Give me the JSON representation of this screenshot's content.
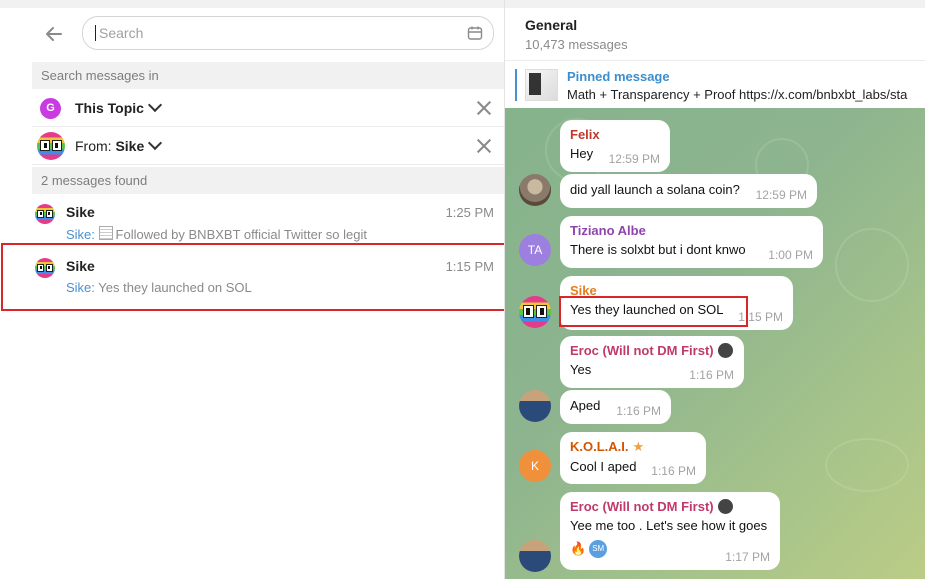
{
  "search": {
    "placeholder": "Search",
    "search_in_label": "Search messages in",
    "topic_filter": {
      "avatar_letter": "G",
      "label": "This Topic"
    },
    "from_filter": {
      "prefix": "From:",
      "name": "Sike"
    },
    "found_label": "2 messages found",
    "results": [
      {
        "name": "Sike",
        "time": "1:25 PM",
        "who": "Sike:",
        "snippet": "Followed by BNBXBT official Twitter so legit"
      },
      {
        "name": "Sike",
        "time": "1:15 PM",
        "who": "Sike:",
        "snippet": "Yes they launched on SOL"
      }
    ]
  },
  "chat": {
    "title": "General",
    "subtitle": "10,473 messages",
    "pinned": {
      "label": "Pinned message",
      "text": "Math + Transparency + Proof  https://x.com/bnbxbt_labs/sta"
    },
    "messages": [
      {
        "sender": "Felix",
        "text": "Hey",
        "time": "12:59 PM",
        "color": "#c0392b"
      },
      {
        "sender": "",
        "text": "did yall launch a solana coin?",
        "time": "12:59 PM"
      },
      {
        "sender": "Tiziano Albe",
        "text": "There is solxbt but i dont knwo",
        "time": "1:00 PM",
        "color": "#8e44ad",
        "avatar": "TA"
      },
      {
        "sender": "Sike",
        "text": "Yes they launched on SOL",
        "time": "1:15 PM",
        "color": "#e67e22"
      },
      {
        "sender": "Eroc (Will not DM First)",
        "text": "Yes",
        "time": "1:16 PM",
        "color": "#c0396b"
      },
      {
        "sender": "",
        "text": "Aped",
        "time": "1:16 PM"
      },
      {
        "sender": "K.O.L.A.I.",
        "text": "Cool I aped",
        "time": "1:16 PM",
        "color": "#d35400",
        "avatar": "K"
      },
      {
        "sender": "Eroc (Will not DM First)",
        "text": "Yee me too . Let's see how it goes",
        "time": "1:17 PM",
        "color": "#c0396b",
        "reaction_badge": "SM"
      }
    ]
  },
  "colors": {
    "accent": "#4a90d0",
    "highlight": "#d8262a",
    "chat_bg": "#8db48f"
  }
}
